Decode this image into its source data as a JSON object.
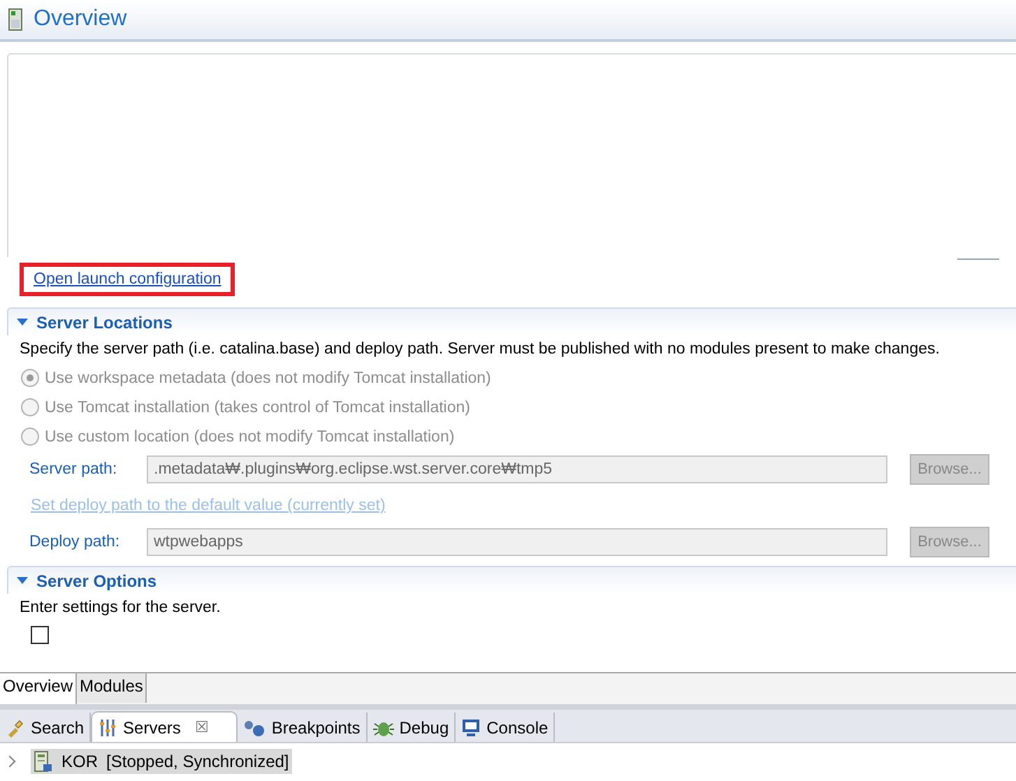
{
  "editor": {
    "title": "Overview",
    "launch_link": {
      "label": "Open launch configuration",
      "highlighted": true
    },
    "sections": [
      {
        "title": "Server Locations",
        "expanded": true,
        "description": "Specify the server path (i.e. catalina.base) and deploy path. Server must be published with no modules present to make changes.",
        "radios": [
          {
            "label": "Use workspace metadata (does not modify Tomcat installation)",
            "selected": true,
            "disabled": true
          },
          {
            "label": "Use Tomcat installation (takes control of Tomcat installation)",
            "selected": false,
            "disabled": true
          },
          {
            "label": "Use custom location (does not modify Tomcat installation)",
            "selected": false,
            "disabled": true
          }
        ],
        "fields": [
          {
            "label": "Server path:",
            "value": ".metadata₩.plugins₩org.eclipse.wst.server.core₩tmp5",
            "button": "Browse...",
            "disabled": true
          },
          {
            "kind": "link",
            "label": "Set deploy path to the default value (currently set)",
            "disabled": true
          },
          {
            "label": "Deploy path:",
            "value": "wtpwebapps",
            "button": "Browse...",
            "disabled": true
          }
        ]
      },
      {
        "title": "Server Options",
        "expanded": true,
        "description": "Enter settings for the server.",
        "checkboxes": [
          {
            "checked": false
          }
        ]
      }
    ],
    "tabs": [
      {
        "label": "Overview",
        "selected": true
      },
      {
        "label": "Modules",
        "selected": false
      }
    ]
  },
  "views": {
    "tabs": [
      {
        "label": "Search",
        "kind": "search",
        "selected": false,
        "closable": false
      },
      {
        "label": "Servers",
        "kind": "servers",
        "selected": true,
        "closable": true,
        "close": "☒"
      },
      {
        "label": "Breakpoints",
        "kind": "breakpoints",
        "selected": false,
        "closable": false
      },
      {
        "label": "Debug",
        "kind": "debug",
        "selected": false,
        "closable": false
      },
      {
        "label": "Console",
        "kind": "console",
        "selected": false,
        "closable": false
      }
    ],
    "tree": [
      {
        "name": "KOR",
        "status": "[Stopped, Synchronized]",
        "expanded": false,
        "selected": true
      }
    ]
  }
}
